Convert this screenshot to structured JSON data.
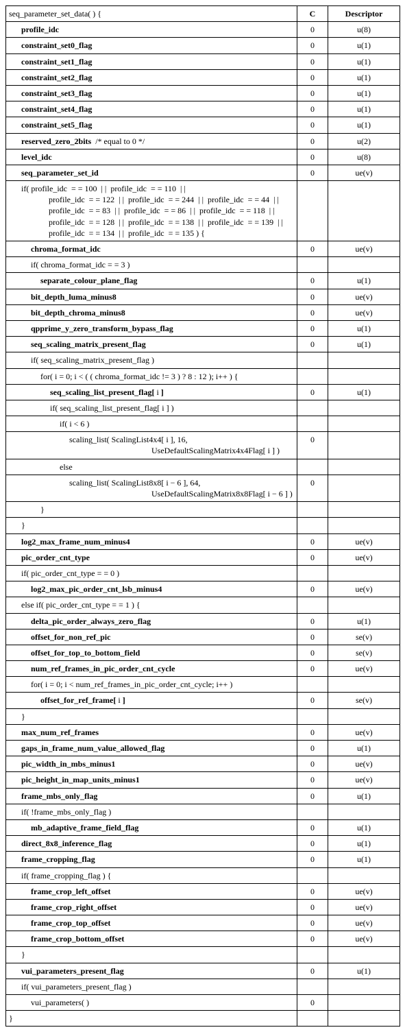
{
  "headers": {
    "c": "C",
    "descriptor": "Descriptor"
  },
  "rows": [
    {
      "syntax": "seq_parameter_set_data( ) {",
      "indent": 0,
      "bold": false,
      "c": "",
      "desc": ""
    },
    {
      "syntax": "profile_idc",
      "indent": 1,
      "bold": true,
      "c": "0",
      "desc": "u(8)"
    },
    {
      "syntax": "constraint_set0_flag",
      "indent": 1,
      "bold": true,
      "c": "0",
      "desc": "u(1)"
    },
    {
      "syntax": "constraint_set1_flag",
      "indent": 1,
      "bold": true,
      "c": "0",
      "desc": "u(1)"
    },
    {
      "syntax": "constraint_set2_flag",
      "indent": 1,
      "bold": true,
      "c": "0",
      "desc": "u(1)"
    },
    {
      "syntax": "constraint_set3_flag",
      "indent": 1,
      "bold": true,
      "c": "0",
      "desc": "u(1)"
    },
    {
      "syntax": "constraint_set4_flag",
      "indent": 1,
      "bold": true,
      "c": "0",
      "desc": "u(1)"
    },
    {
      "syntax": "constraint_set5_flag",
      "indent": 1,
      "bold": true,
      "c": "0",
      "desc": "u(1)"
    },
    {
      "syntax_html": "<span class='b'>reserved_zero_2bits</span>&nbsp;&nbsp;/* equal to 0 */",
      "indent": 1,
      "bold": false,
      "c": "0",
      "desc": "u(2)"
    },
    {
      "syntax": "level_idc",
      "indent": 1,
      "bold": true,
      "c": "0",
      "desc": "u(8)"
    },
    {
      "syntax": "seq_parameter_set_id",
      "indent": 1,
      "bold": true,
      "c": "0",
      "desc": "ue(v)"
    },
    {
      "syntax_html": "if( profile_idc&nbsp;&nbsp;= = 100&nbsp;&nbsp;| |&nbsp;&nbsp;profile_idc&nbsp;&nbsp;= = 110&nbsp;&nbsp;| |<br><span class='contb'>profile_idc&nbsp;&nbsp;= = 122&nbsp;&nbsp;| |&nbsp;&nbsp;profile_idc&nbsp;&nbsp;= = 244&nbsp;&nbsp;| |&nbsp;&nbsp;profile_idc&nbsp;&nbsp;= = 44&nbsp;&nbsp;| |</span><span class='contb'>profile_idc&nbsp;&nbsp;= = 83&nbsp;&nbsp;| |&nbsp;&nbsp;profile_idc&nbsp;&nbsp;= = 86&nbsp;&nbsp;| |&nbsp;&nbsp;profile_idc&nbsp;&nbsp;= = 118&nbsp;&nbsp;| |</span><span class='contb'>profile_idc&nbsp;&nbsp;= = 128&nbsp;&nbsp;| |&nbsp;&nbsp;profile_idc&nbsp;&nbsp;= = 138&nbsp;&nbsp;| |&nbsp;&nbsp;profile_idc&nbsp;&nbsp;= = 139&nbsp;&nbsp;| |</span><span class='contb'>profile_idc&nbsp;&nbsp;= = 134&nbsp;&nbsp;| |&nbsp;&nbsp;profile_idc&nbsp;&nbsp;= = 135 ) {</span>",
      "indent": 1,
      "bold": false,
      "c": "",
      "desc": ""
    },
    {
      "syntax": "chroma_format_idc",
      "indent": 2,
      "bold": true,
      "c": "0",
      "desc": "ue(v)"
    },
    {
      "syntax": "if( chroma_format_idc  = =  3 )",
      "indent": 2,
      "bold": false,
      "c": "",
      "desc": ""
    },
    {
      "syntax": "separate_colour_plane_flag",
      "indent": 3,
      "bold": true,
      "c": "0",
      "desc": "u(1)"
    },
    {
      "syntax": "bit_depth_luma_minus8",
      "indent": 2,
      "bold": true,
      "c": "0",
      "desc": "ue(v)"
    },
    {
      "syntax": "bit_depth_chroma_minus8",
      "indent": 2,
      "bold": true,
      "c": "0",
      "desc": "ue(v)"
    },
    {
      "syntax": "qpprime_y_zero_transform_bypass_flag",
      "indent": 2,
      "bold": true,
      "c": "0",
      "desc": "u(1)"
    },
    {
      "syntax": "seq_scaling_matrix_present_flag",
      "indent": 2,
      "bold": true,
      "c": "0",
      "desc": "u(1)"
    },
    {
      "syntax": "if( seq_scaling_matrix_present_flag )",
      "indent": 2,
      "bold": false,
      "c": "",
      "desc": ""
    },
    {
      "syntax": "for( i = 0; i < ( ( chroma_format_idc  !=  3 ) ? 8 : 12 ); i++ ) {",
      "indent": 3,
      "bold": false,
      "c": "",
      "desc": ""
    },
    {
      "syntax_html": "<span class='b'>seq_scaling_list_present_flag[</span> i <span class='b'>]</span>",
      "indent": 4,
      "bold": false,
      "c": "0",
      "desc": "u(1)"
    },
    {
      "syntax": "if( seq_scaling_list_present_flag[ i ] )",
      "indent": 4,
      "bold": false,
      "c": "",
      "desc": ""
    },
    {
      "syntax": "if( i < 6 )",
      "indent": 5,
      "bold": false,
      "c": "",
      "desc": ""
    },
    {
      "syntax_html": "scaling_list( ScalingList4x4[ i ], 16,<br><span class='cont'>UseDefaultScalingMatrix4x4Flag[ i ] )</span>",
      "indent": 6,
      "bold": false,
      "c": "0",
      "desc": ""
    },
    {
      "syntax": "else",
      "indent": 5,
      "bold": false,
      "c": "",
      "desc": ""
    },
    {
      "syntax_html": "scaling_list( ScalingList8x8[ i − 6 ], 64,<br><span class='cont'>UseDefaultScalingMatrix8x8Flag[ i − 6 ] )</span>",
      "indent": 6,
      "bold": false,
      "c": "0",
      "desc": ""
    },
    {
      "syntax": "}",
      "indent": 3,
      "bold": false,
      "c": "",
      "desc": ""
    },
    {
      "syntax": "}",
      "indent": 1,
      "bold": false,
      "c": "",
      "desc": ""
    },
    {
      "syntax": "log2_max_frame_num_minus4",
      "indent": 1,
      "bold": true,
      "c": "0",
      "desc": "ue(v)"
    },
    {
      "syntax": "pic_order_cnt_type",
      "indent": 1,
      "bold": true,
      "c": "0",
      "desc": "ue(v)"
    },
    {
      "syntax": "if( pic_order_cnt_type  = =  0 )",
      "indent": 1,
      "bold": false,
      "c": "",
      "desc": ""
    },
    {
      "syntax": "log2_max_pic_order_cnt_lsb_minus4",
      "indent": 2,
      "bold": true,
      "c": "0",
      "desc": "ue(v)"
    },
    {
      "syntax": "else if( pic_order_cnt_type  = =  1 ) {",
      "indent": 1,
      "bold": false,
      "c": "",
      "desc": ""
    },
    {
      "syntax": "delta_pic_order_always_zero_flag",
      "indent": 2,
      "bold": true,
      "c": "0",
      "desc": "u(1)"
    },
    {
      "syntax": "offset_for_non_ref_pic",
      "indent": 2,
      "bold": true,
      "c": "0",
      "desc": "se(v)"
    },
    {
      "syntax": "offset_for_top_to_bottom_field",
      "indent": 2,
      "bold": true,
      "c": "0",
      "desc": "se(v)"
    },
    {
      "syntax": "num_ref_frames_in_pic_order_cnt_cycle",
      "indent": 2,
      "bold": true,
      "c": "0",
      "desc": "ue(v)"
    },
    {
      "syntax": "for( i = 0; i < num_ref_frames_in_pic_order_cnt_cycle; i++ )",
      "indent": 2,
      "bold": false,
      "c": "",
      "desc": ""
    },
    {
      "syntax_html": "<span class='b'>offset_for_ref_frame[</span> i <span class='b'>]</span>",
      "indent": 3,
      "bold": false,
      "c": "0",
      "desc": "se(v)"
    },
    {
      "syntax": "}",
      "indent": 1,
      "bold": false,
      "c": "",
      "desc": ""
    },
    {
      "syntax": "max_num_ref_frames",
      "indent": 1,
      "bold": true,
      "c": "0",
      "desc": "ue(v)"
    },
    {
      "syntax": "gaps_in_frame_num_value_allowed_flag",
      "indent": 1,
      "bold": true,
      "c": "0",
      "desc": "u(1)"
    },
    {
      "syntax": "pic_width_in_mbs_minus1",
      "indent": 1,
      "bold": true,
      "c": "0",
      "desc": "ue(v)"
    },
    {
      "syntax": "pic_height_in_map_units_minus1",
      "indent": 1,
      "bold": true,
      "c": "0",
      "desc": "ue(v)"
    },
    {
      "syntax": "frame_mbs_only_flag",
      "indent": 1,
      "bold": true,
      "c": "0",
      "desc": "u(1)"
    },
    {
      "syntax": "if( !frame_mbs_only_flag )",
      "indent": 1,
      "bold": false,
      "c": "",
      "desc": ""
    },
    {
      "syntax": "mb_adaptive_frame_field_flag",
      "indent": 2,
      "bold": true,
      "c": "0",
      "desc": "u(1)"
    },
    {
      "syntax": "direct_8x8_inference_flag",
      "indent": 1,
      "bold": true,
      "c": "0",
      "desc": "u(1)"
    },
    {
      "syntax": "frame_cropping_flag",
      "indent": 1,
      "bold": true,
      "c": "0",
      "desc": "u(1)"
    },
    {
      "syntax": "if( frame_cropping_flag ) {",
      "indent": 1,
      "bold": false,
      "c": "",
      "desc": ""
    },
    {
      "syntax": "frame_crop_left_offset",
      "indent": 2,
      "bold": true,
      "c": "0",
      "desc": "ue(v)"
    },
    {
      "syntax": "frame_crop_right_offset",
      "indent": 2,
      "bold": true,
      "c": "0",
      "desc": "ue(v)"
    },
    {
      "syntax": "frame_crop_top_offset",
      "indent": 2,
      "bold": true,
      "c": "0",
      "desc": "ue(v)"
    },
    {
      "syntax": "frame_crop_bottom_offset",
      "indent": 2,
      "bold": true,
      "c": "0",
      "desc": "ue(v)"
    },
    {
      "syntax": "}",
      "indent": 1,
      "bold": false,
      "c": "",
      "desc": ""
    },
    {
      "syntax": "vui_parameters_present_flag",
      "indent": 1,
      "bold": true,
      "c": "0",
      "desc": "u(1)"
    },
    {
      "syntax": "if( vui_parameters_present_flag )",
      "indent": 1,
      "bold": false,
      "c": "",
      "desc": ""
    },
    {
      "syntax": "vui_parameters( )",
      "indent": 2,
      "bold": false,
      "c": "0",
      "desc": ""
    },
    {
      "syntax": "}",
      "indent": 0,
      "bold": false,
      "c": "",
      "desc": ""
    }
  ]
}
